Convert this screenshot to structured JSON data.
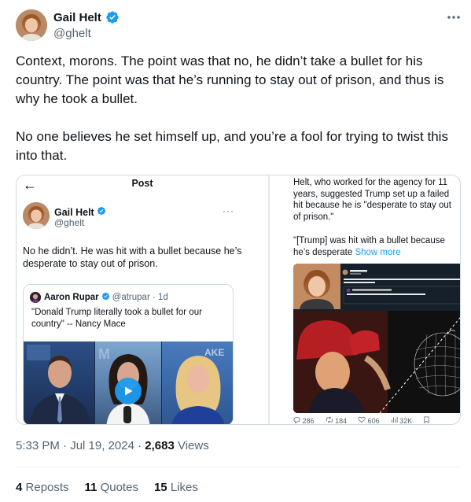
{
  "author": {
    "display_name": "Gail Helt",
    "handle": "@ghelt"
  },
  "tweet": {
    "paragraphs": [
      "Context, morons. The point was that no, he didn’t take a bullet for his country. The point was that he’s running to stay out of prison, and thus is why he took a bullet.",
      "No one believes he set himself up, and you’re a fool for trying to twist this into that."
    ]
  },
  "media_left": {
    "back_icon": "←",
    "header_title": "Post",
    "name": "Gail Helt",
    "handle": "@ghelt",
    "more": "···",
    "text": "No he didn’t. He was hit with a bullet because he’s desperate to stay out of prison.",
    "quote": {
      "name": "Aaron Rupar",
      "handle_time": "@atrupar · 1d",
      "text": "\"Donald Trump literally took a bullet for our country\" -- Nancy Mace"
    }
  },
  "media_right": {
    "article_text": "Helt, who worked for the agency for 11 years, suggested Trump set up a failed hit because he is \"desperate to stay out of prison.\"",
    "quote_text": "\"[Trump] was hit with a bullet because he’s desperate",
    "show_more": "Show more",
    "actions": [
      "286",
      "184",
      "606",
      "32K"
    ]
  },
  "meta": {
    "time": "5:33 PM · Jul 19, 2024 · ",
    "views_count": "2,683",
    "views_label": " Views"
  },
  "stats": {
    "reposts_count": "4",
    "reposts_label": "Reposts",
    "quotes_count": "11",
    "quotes_label": "Quotes",
    "likes_count": "15",
    "likes_label": "Likes"
  },
  "colors": {
    "accent": "#1d9bf0",
    "text": "#0f1419",
    "muted": "#536471",
    "border": "#cfd9de"
  }
}
